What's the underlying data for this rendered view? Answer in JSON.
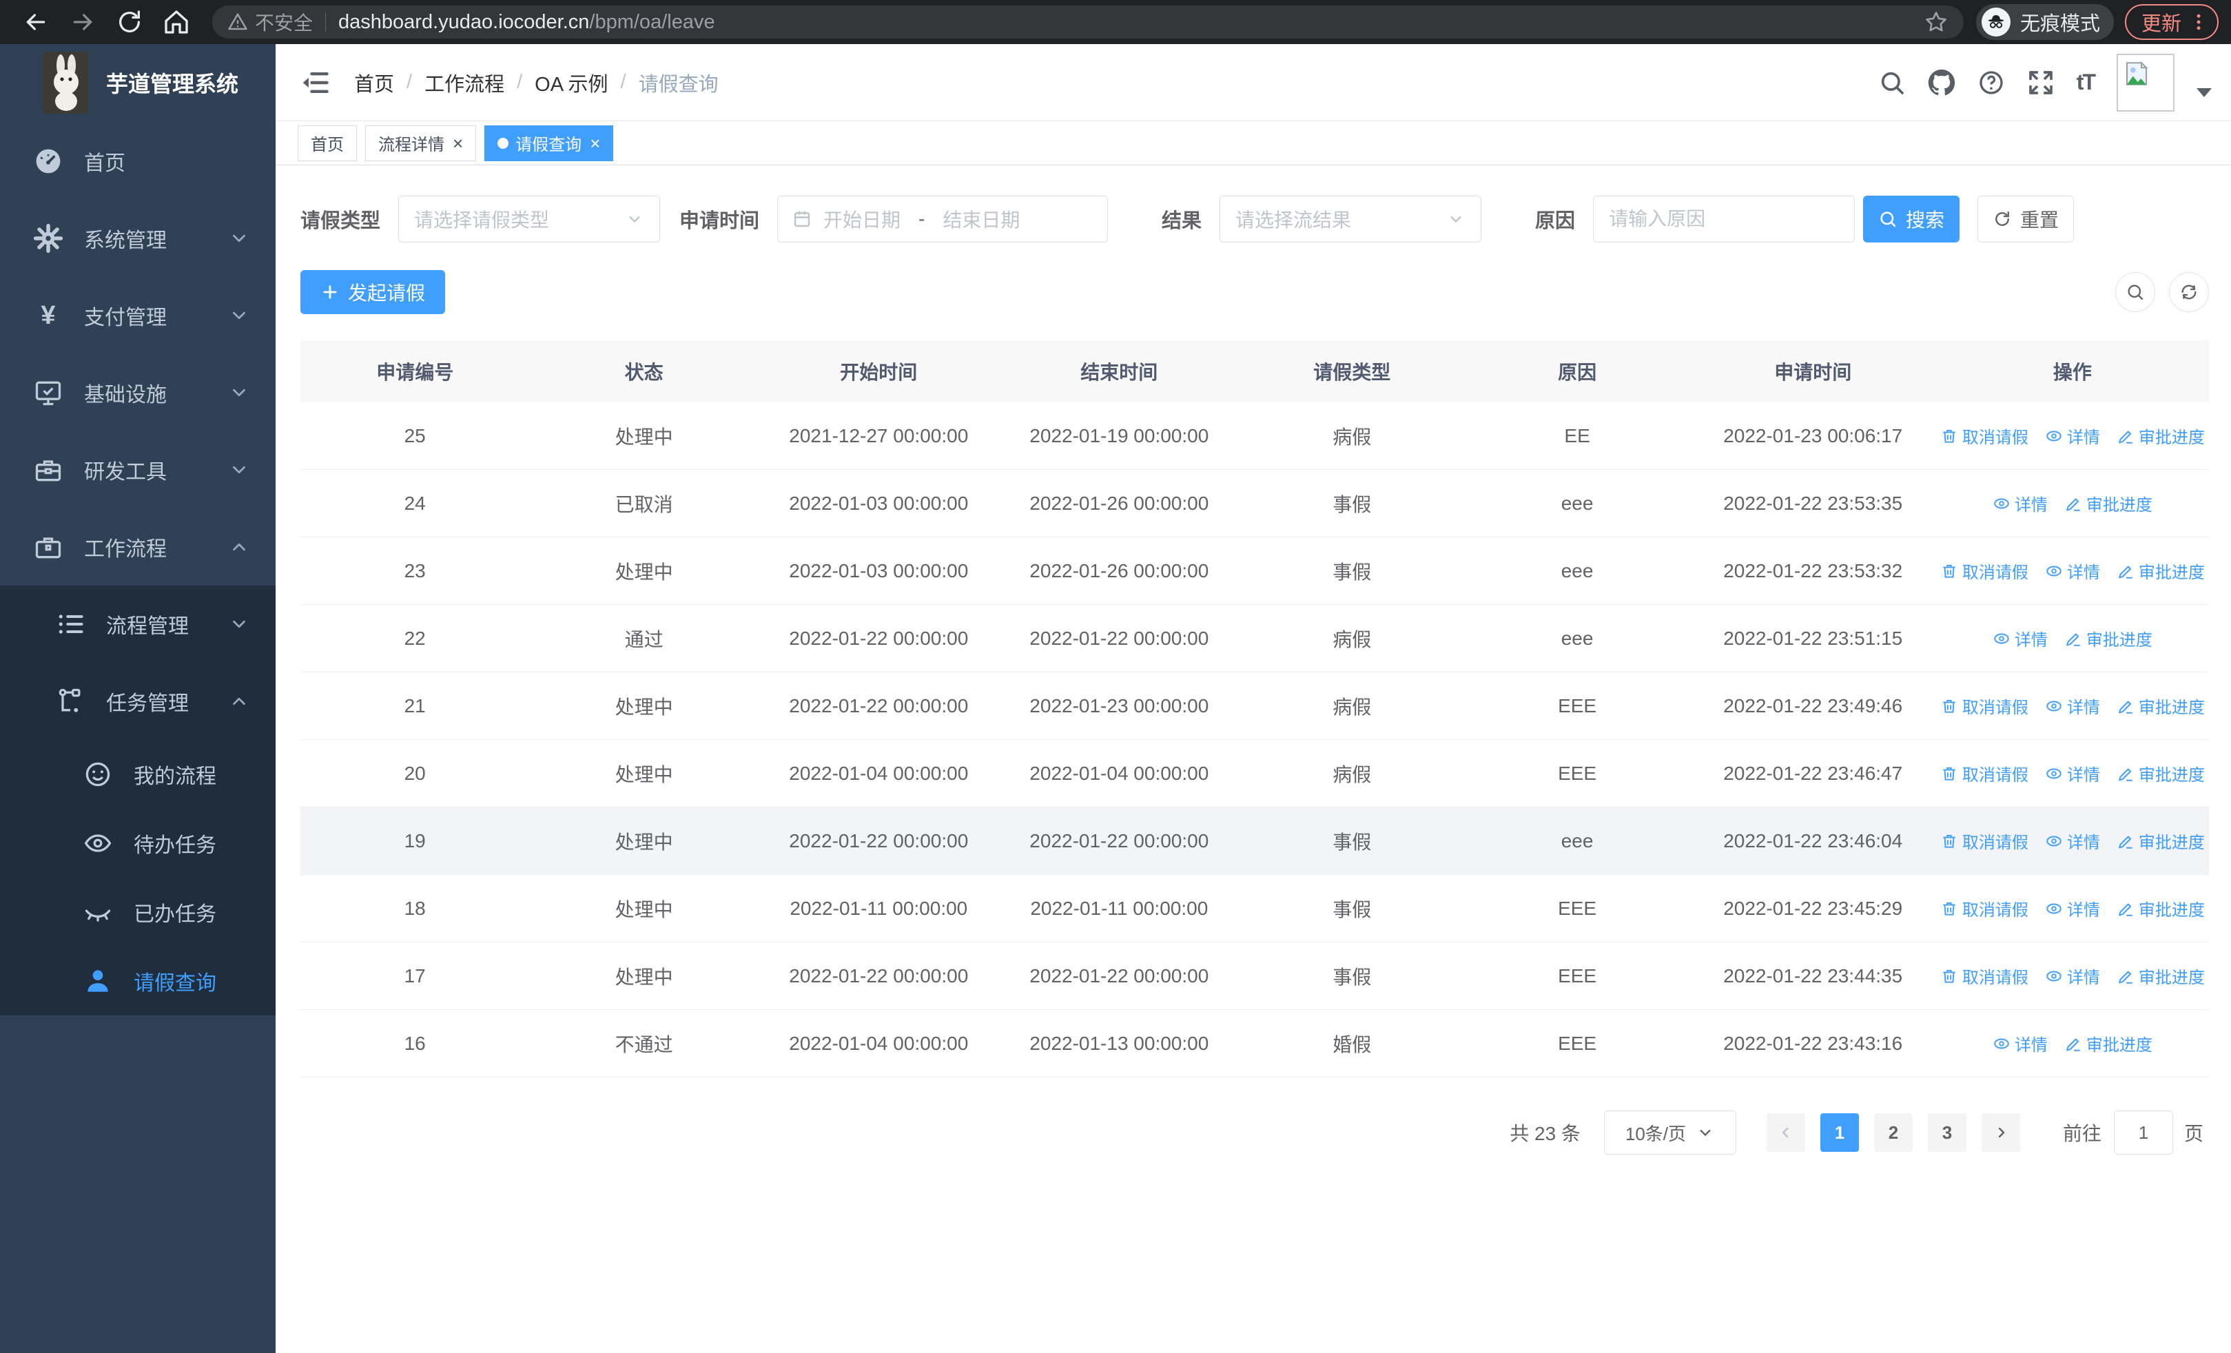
{
  "colors": {
    "primary": "#409eff",
    "sidebar_bg": "#304156",
    "submenu_bg": "#1f2d3d",
    "update_accent": "#f28b82",
    "table_header_bg": "#f8f8f9"
  },
  "browser": {
    "security_label": "不安全",
    "url_host": "dashboard.yudao.iocoder.cn",
    "url_path": "/bpm/oa/leave",
    "incognito_label": "无痕模式",
    "update_label": "更新"
  },
  "app": {
    "title": "芋道管理系统",
    "breadcrumb": [
      "首页",
      "工作流程",
      "OA 示例",
      "请假查询"
    ],
    "tabs": [
      {
        "label": "首页",
        "active": false,
        "closable": false
      },
      {
        "label": "流程详情",
        "active": false,
        "closable": true
      },
      {
        "label": "请假查询",
        "active": true,
        "closable": true
      }
    ]
  },
  "sidebar": {
    "main_items": [
      {
        "label": "首页",
        "icon": "dashboard-icon"
      },
      {
        "label": "系统管理",
        "icon": "gear-icon",
        "arrow": "down"
      },
      {
        "label": "支付管理",
        "icon": "yen-icon",
        "arrow": "down"
      },
      {
        "label": "基础设施",
        "icon": "monitor-icon",
        "arrow": "down"
      },
      {
        "label": "研发工具",
        "icon": "toolbox-icon",
        "arrow": "down"
      },
      {
        "label": "工作流程",
        "icon": "briefcase-icon",
        "arrow": "up"
      }
    ],
    "submenu_items": [
      {
        "label": "流程管理",
        "icon": "list-icon",
        "arrow": "down",
        "level": 1
      },
      {
        "label": "任务管理",
        "icon": "flow-icon",
        "arrow": "up",
        "level": 1
      },
      {
        "label": "我的流程",
        "icon": "face-icon",
        "level": 2
      },
      {
        "label": "待办任务",
        "icon": "eye-open-icon",
        "level": 2
      },
      {
        "label": "已办任务",
        "icon": "eye-closed-icon",
        "level": 2
      },
      {
        "label": "请假查询",
        "icon": "user-icon",
        "level": 2,
        "active": true
      }
    ]
  },
  "filters": {
    "leave_type_label": "请假类型",
    "leave_type_placeholder": "请选择请假类型",
    "apply_time_label": "申请时间",
    "start_date_placeholder": "开始日期",
    "date_separator": "-",
    "end_date_placeholder": "结束日期",
    "result_label": "结果",
    "result_placeholder": "请选择流结果",
    "reason_label": "原因",
    "reason_placeholder": "请输入原因",
    "search_label": "搜索",
    "reset_label": "重置"
  },
  "toolbar": {
    "create_label": "发起请假"
  },
  "table": {
    "columns": [
      "申请编号",
      "状态",
      "开始时间",
      "结束时间",
      "请假类型",
      "原因",
      "申请时间",
      "操作"
    ],
    "action_labels": {
      "cancel": "取消请假",
      "detail": "详情",
      "progress": "审批进度"
    },
    "rows": [
      {
        "id": "25",
        "status": "处理中",
        "start": "2021-12-27 00:00:00",
        "end": "2022-01-19 00:00:00",
        "type": "病假",
        "reason": "EE",
        "applied": "2022-01-23 00:06:17",
        "actions": [
          "cancel",
          "detail",
          "progress"
        ],
        "hover": false
      },
      {
        "id": "24",
        "status": "已取消",
        "start": "2022-01-03 00:00:00",
        "end": "2022-01-26 00:00:00",
        "type": "事假",
        "reason": "eee",
        "applied": "2022-01-22 23:53:35",
        "actions": [
          "detail",
          "progress"
        ],
        "hover": false
      },
      {
        "id": "23",
        "status": "处理中",
        "start": "2022-01-03 00:00:00",
        "end": "2022-01-26 00:00:00",
        "type": "事假",
        "reason": "eee",
        "applied": "2022-01-22 23:53:32",
        "actions": [
          "cancel",
          "detail",
          "progress"
        ],
        "hover": false
      },
      {
        "id": "22",
        "status": "通过",
        "start": "2022-01-22 00:00:00",
        "end": "2022-01-22 00:00:00",
        "type": "病假",
        "reason": "eee",
        "applied": "2022-01-22 23:51:15",
        "actions": [
          "detail",
          "progress"
        ],
        "hover": false
      },
      {
        "id": "21",
        "status": "处理中",
        "start": "2022-01-22 00:00:00",
        "end": "2022-01-23 00:00:00",
        "type": "病假",
        "reason": "EEE",
        "applied": "2022-01-22 23:49:46",
        "actions": [
          "cancel",
          "detail",
          "progress"
        ],
        "hover": false
      },
      {
        "id": "20",
        "status": "处理中",
        "start": "2022-01-04 00:00:00",
        "end": "2022-01-04 00:00:00",
        "type": "病假",
        "reason": "EEE",
        "applied": "2022-01-22 23:46:47",
        "actions": [
          "cancel",
          "detail",
          "progress"
        ],
        "hover": false
      },
      {
        "id": "19",
        "status": "处理中",
        "start": "2022-01-22 00:00:00",
        "end": "2022-01-22 00:00:00",
        "type": "事假",
        "reason": "eee",
        "applied": "2022-01-22 23:46:04",
        "actions": [
          "cancel",
          "detail",
          "progress"
        ],
        "hover": true
      },
      {
        "id": "18",
        "status": "处理中",
        "start": "2022-01-11 00:00:00",
        "end": "2022-01-11 00:00:00",
        "type": "事假",
        "reason": "EEE",
        "applied": "2022-01-22 23:45:29",
        "actions": [
          "cancel",
          "detail",
          "progress"
        ],
        "hover": false
      },
      {
        "id": "17",
        "status": "处理中",
        "start": "2022-01-22 00:00:00",
        "end": "2022-01-22 00:00:00",
        "type": "事假",
        "reason": "EEE",
        "applied": "2022-01-22 23:44:35",
        "actions": [
          "cancel",
          "detail",
          "progress"
        ],
        "hover": false
      },
      {
        "id": "16",
        "status": "不通过",
        "start": "2022-01-04 00:00:00",
        "end": "2022-01-13 00:00:00",
        "type": "婚假",
        "reason": "EEE",
        "applied": "2022-01-22 23:43:16",
        "actions": [
          "detail",
          "progress"
        ],
        "hover": false
      }
    ]
  },
  "pagination": {
    "total_label": "共 23 条",
    "page_size": "10条/页",
    "pages": [
      "1",
      "2",
      "3"
    ],
    "active_page": "1",
    "goto_label": "前往",
    "goto_value": "1",
    "page_unit": "页"
  }
}
